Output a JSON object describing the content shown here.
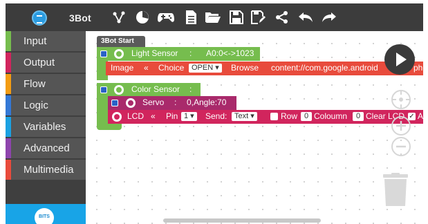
{
  "toolbar": {
    "brand": "3Bot",
    "icons": [
      "logo-icon",
      "share-graph-icon",
      "pie-chart-icon",
      "gamepad-icon",
      "document-icon",
      "folder-open-icon",
      "save-icon",
      "save-as-icon",
      "share-icon",
      "undo-icon",
      "redo-icon"
    ]
  },
  "sidebar": {
    "items": [
      {
        "label": "Input",
        "color": "#76bd4e"
      },
      {
        "label": "Output",
        "color": "#d1255d"
      },
      {
        "label": "Flow",
        "color": "#f39c12"
      },
      {
        "label": "Logic",
        "color": "#3478d6"
      },
      {
        "label": "Variables",
        "color": "#1ba1e2"
      },
      {
        "label": "Advanced",
        "color": "#8e44ad"
      },
      {
        "label": "Multimedia",
        "color": "#e84b3c"
      }
    ],
    "footer_logo": "BITS"
  },
  "workspace": {
    "start_block": "3Bot Start",
    "light_sensor": {
      "label": "Light Sensor",
      "sep": ":",
      "value": "A0:0<->1023"
    },
    "image_block": {
      "label": "Image",
      "arrow": "«",
      "choice_label": "Choice",
      "choice_value": "OPEN",
      "browse": "Browse",
      "path": "content://com.google.android",
      "path_end": "pho"
    },
    "color_sensor": {
      "label": "Color Sensor",
      "sep": ":"
    },
    "servo": {
      "label": "Servo",
      "sep": ":",
      "value": "0,Angle:70"
    },
    "lcd": {
      "label": "LCD",
      "arrow": "«",
      "pin_label": "Pin",
      "pin_value": "1",
      "send_label": "Send:",
      "send_value": "Text",
      "row_label": "Row",
      "row_value": "0",
      "col_label": "Coloumn",
      "col_value": "0",
      "clear_label": "Clear LCD",
      "au_label": "Au"
    }
  },
  "colors": {
    "toolbar": "#3c3c3c",
    "sidebar": "#3f3f3f",
    "accent": "#18a4e7",
    "input": "#76bd4e",
    "red": "#e84b3c",
    "servo": "#a92a6b",
    "lcd": "#d1255d"
  }
}
